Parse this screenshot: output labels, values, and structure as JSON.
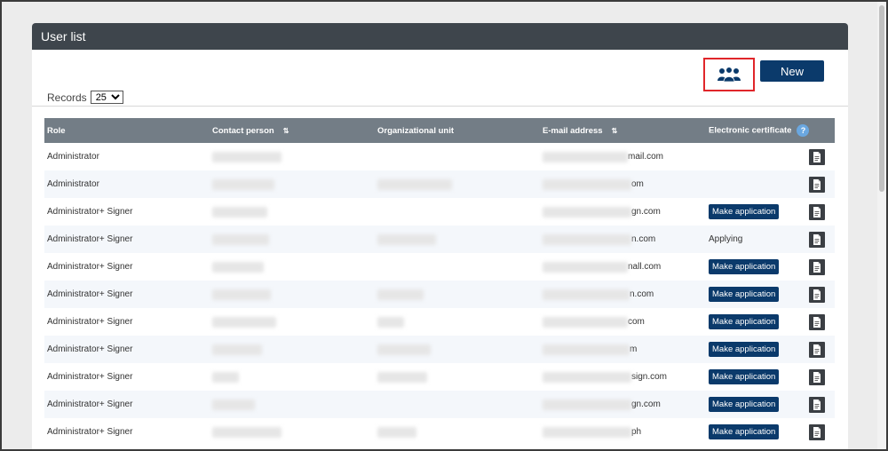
{
  "panel": {
    "title": "User list"
  },
  "toolbar": {
    "group_icon": "users-group-icon",
    "new_label": "New"
  },
  "records": {
    "label": "Records",
    "selected": "25"
  },
  "table": {
    "headers": {
      "role": "Role",
      "contact": "Contact person",
      "org_unit": "Organizational unit",
      "email": "E-mail address",
      "cert": "Electronic certificate"
    },
    "sort_icon": "⇅",
    "help_icon": "?",
    "rows": [
      {
        "role": "Administrator",
        "email_suffix": "mail.com",
        "cert": ""
      },
      {
        "role": "Administrator",
        "email_suffix": "om",
        "cert": ""
      },
      {
        "role": "Administrator+ Signer",
        "email_suffix": "gn.com",
        "cert": "Make application"
      },
      {
        "role": "Administrator+ Signer",
        "email_suffix": "n.com",
        "cert": "Applying"
      },
      {
        "role": "Administrator+ Signer",
        "email_suffix": "nall.com",
        "cert": "Make application"
      },
      {
        "role": "Administrator+ Signer",
        "email_suffix": "n.com",
        "cert": "Make application"
      },
      {
        "role": "Administrator+ Signer",
        "email_suffix": "com",
        "cert": "Make application"
      },
      {
        "role": "Administrator+ Signer",
        "email_suffix": "m",
        "cert": "Make application"
      },
      {
        "role": "Administrator+ Signer",
        "email_suffix": "sign.com",
        "cert": "Make application"
      },
      {
        "role": "Administrator+ Signer",
        "email_suffix": "gn.com",
        "cert": "Make application"
      },
      {
        "role": "Administrator+ Signer",
        "email_suffix": "ph",
        "cert": "Make application"
      }
    ]
  },
  "colors": {
    "header_bar": "#3e454c",
    "table_header": "#737d86",
    "primary": "#0b3a6b",
    "highlight": "#e0262a"
  }
}
